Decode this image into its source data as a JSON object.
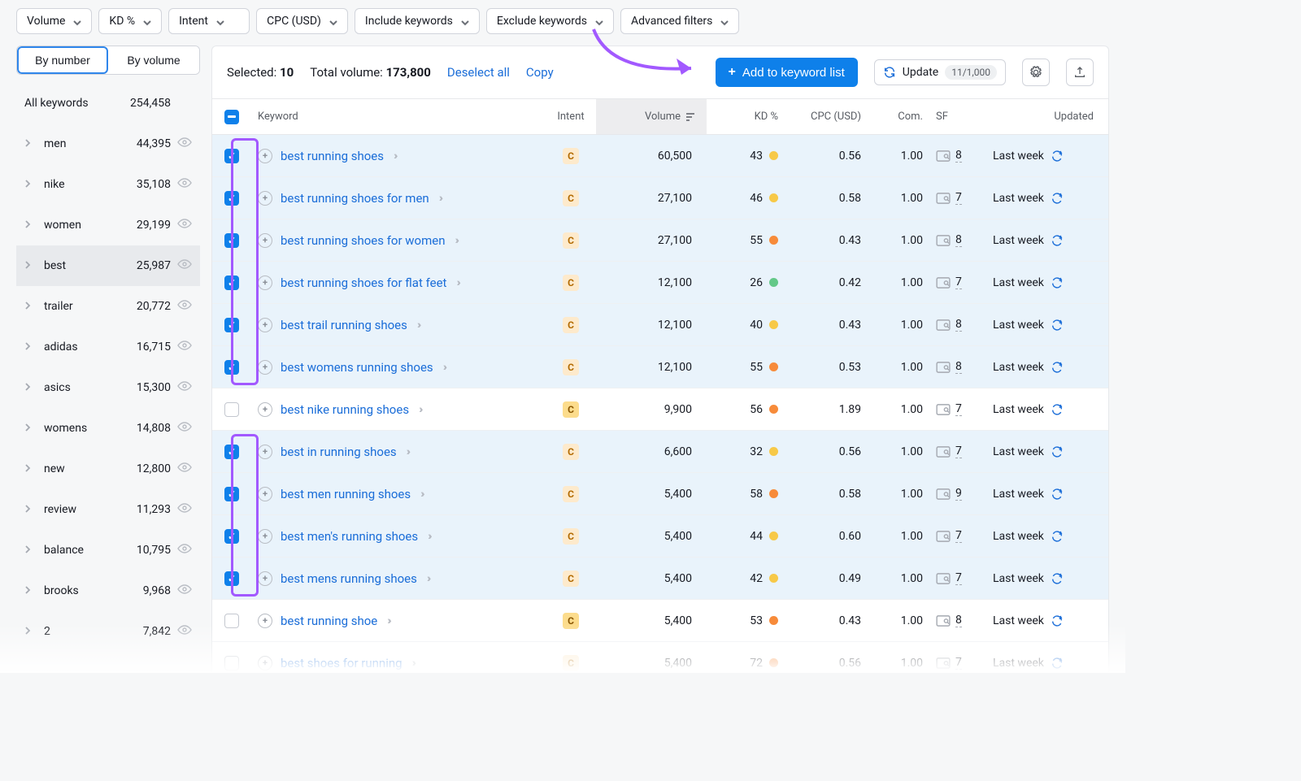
{
  "filters": {
    "volume": "Volume",
    "kd": "KD %",
    "intent": "Intent",
    "cpc": "CPC (USD)",
    "include": "Include keywords",
    "exclude": "Exclude keywords",
    "advanced": "Advanced filters"
  },
  "seg": {
    "number": "By number",
    "volume": "By volume"
  },
  "sidebar": {
    "all_label": "All keywords",
    "all_count": "254,458",
    "items": [
      {
        "name": "men",
        "count": "44,395"
      },
      {
        "name": "nike",
        "count": "35,108"
      },
      {
        "name": "women",
        "count": "29,199"
      },
      {
        "name": "best",
        "count": "25,987"
      },
      {
        "name": "trailer",
        "count": "20,772"
      },
      {
        "name": "adidas",
        "count": "16,715"
      },
      {
        "name": "asics",
        "count": "15,300"
      },
      {
        "name": "womens",
        "count": "14,808"
      },
      {
        "name": "new",
        "count": "12,800"
      },
      {
        "name": "review",
        "count": "11,293"
      },
      {
        "name": "balance",
        "count": "10,795"
      },
      {
        "name": "brooks",
        "count": "9,968"
      },
      {
        "name": "2",
        "count": "7,842"
      }
    ]
  },
  "toolbar": {
    "selected_label": "Selected:",
    "selected_count": "10",
    "total_label": "Total volume:",
    "total_value": "173,800",
    "deselect": "Deselect all",
    "copy": "Copy",
    "add": "Add to keyword list",
    "update": "Update",
    "update_count": "11/1,000"
  },
  "headers": {
    "keyword": "Keyword",
    "intent": "Intent",
    "volume": "Volume",
    "kd": "KD %",
    "cpc": "CPC (USD)",
    "com": "Com.",
    "sf": "SF",
    "updated": "Updated"
  },
  "rows": [
    {
      "checked": true,
      "kw": "best running shoes",
      "intent": "c1",
      "vol": "60,500",
      "kd": "43",
      "dot": "y",
      "cpc": "0.56",
      "com": "1.00",
      "sf": "8",
      "upd": "Last week"
    },
    {
      "checked": true,
      "kw": "best running shoes for men",
      "intent": "c1",
      "vol": "27,100",
      "kd": "46",
      "dot": "y",
      "cpc": "0.58",
      "com": "1.00",
      "sf": "7",
      "upd": "Last week"
    },
    {
      "checked": true,
      "kw": "best running shoes for women",
      "intent": "c1",
      "vol": "27,100",
      "kd": "55",
      "dot": "o",
      "cpc": "0.43",
      "com": "1.00",
      "sf": "8",
      "upd": "Last week"
    },
    {
      "checked": true,
      "kw": "best running shoes for flat feet",
      "intent": "c1",
      "vol": "12,100",
      "kd": "26",
      "dot": "g",
      "cpc": "0.42",
      "com": "1.00",
      "sf": "7",
      "upd": "Last week"
    },
    {
      "checked": true,
      "kw": "best trail running shoes",
      "intent": "c1",
      "vol": "12,100",
      "kd": "40",
      "dot": "y",
      "cpc": "0.43",
      "com": "1.00",
      "sf": "8",
      "upd": "Last week"
    },
    {
      "checked": true,
      "kw": "best womens running shoes",
      "intent": "c1",
      "vol": "12,100",
      "kd": "55",
      "dot": "o",
      "cpc": "0.53",
      "com": "1.00",
      "sf": "8",
      "upd": "Last week"
    },
    {
      "checked": false,
      "kw": "best nike running shoes",
      "intent": "c2",
      "vol": "9,900",
      "kd": "56",
      "dot": "o",
      "cpc": "1.89",
      "com": "1.00",
      "sf": "7",
      "upd": "Last week"
    },
    {
      "checked": true,
      "kw": "best in running shoes",
      "intent": "c1",
      "vol": "6,600",
      "kd": "32",
      "dot": "y",
      "cpc": "0.56",
      "com": "1.00",
      "sf": "7",
      "upd": "Last week"
    },
    {
      "checked": true,
      "kw": "best men running shoes",
      "intent": "c1",
      "vol": "5,400",
      "kd": "58",
      "dot": "o",
      "cpc": "0.58",
      "com": "1.00",
      "sf": "9",
      "upd": "Last week"
    },
    {
      "checked": true,
      "kw": "best men's running shoes",
      "intent": "c1",
      "vol": "5,400",
      "kd": "44",
      "dot": "y",
      "cpc": "0.60",
      "com": "1.00",
      "sf": "7",
      "upd": "Last week"
    },
    {
      "checked": true,
      "kw": "best mens running shoes",
      "intent": "c1",
      "vol": "5,400",
      "kd": "42",
      "dot": "y",
      "cpc": "0.49",
      "com": "1.00",
      "sf": "7",
      "upd": "Last week"
    },
    {
      "checked": false,
      "kw": "best running shoe",
      "intent": "c2",
      "vol": "5,400",
      "kd": "53",
      "dot": "o",
      "cpc": "0.43",
      "com": "1.00",
      "sf": "8",
      "upd": "Last week"
    },
    {
      "checked": false,
      "kw": "best shoes for running",
      "intent": "c1",
      "vol": "5,400",
      "kd": "72",
      "dot": "o",
      "cpc": "0.56",
      "com": "1.00",
      "sf": "7",
      "upd": "Last week"
    }
  ]
}
